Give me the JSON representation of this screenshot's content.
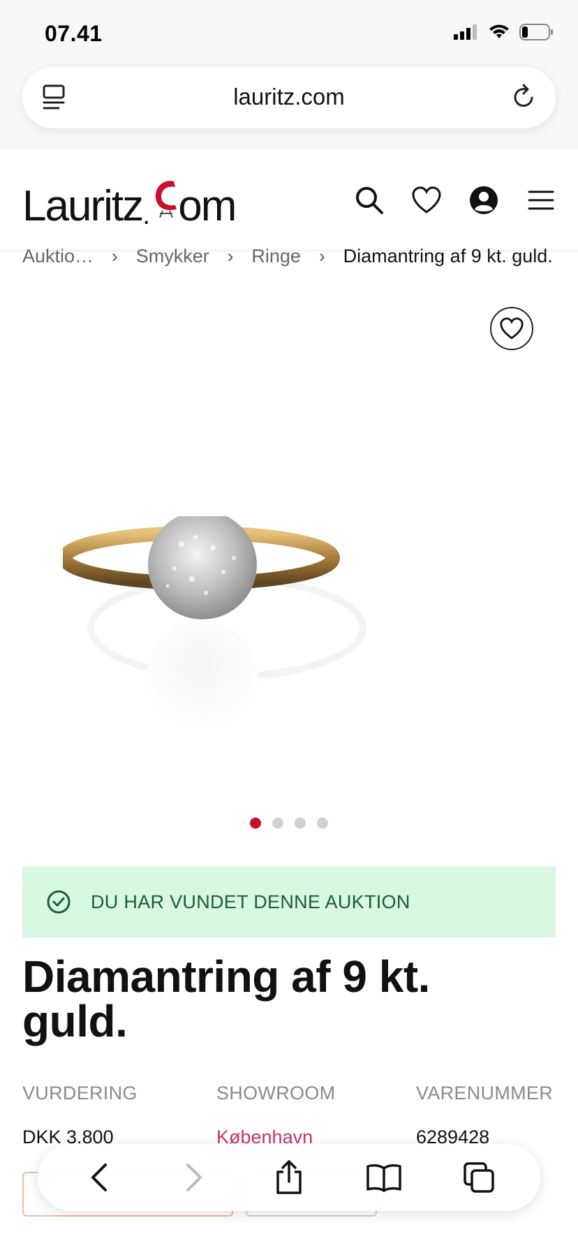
{
  "status_bar": {
    "time": "07.41"
  },
  "browser": {
    "url": "lauritz.com"
  },
  "site": {
    "logo_text_left": "Lauritz",
    "logo_text_right": "om",
    "logo_dot": ".",
    "header_icons": [
      "search-icon",
      "heart-icon",
      "user-icon",
      "menu-icon"
    ]
  },
  "breadcrumb": [
    {
      "label": "Auktio…"
    },
    {
      "label": "Smykker"
    },
    {
      "label": "Ringe"
    },
    {
      "label": "Diamantring af 9 kt. guld."
    }
  ],
  "gallery": {
    "total_images": 4,
    "active_index": 0
  },
  "won_banner": {
    "text": "DU HAR VUNDET DENNE AUKTION"
  },
  "product": {
    "title": "Diamantring af 9 kt. guld.",
    "info": [
      {
        "label": "VURDERING",
        "value": "DKK 3.800"
      },
      {
        "label": "SHOWROOM",
        "value": "København"
      },
      {
        "label": "VARENUMMER",
        "value": "6289428"
      }
    ]
  },
  "colors": {
    "accent": "#c8102e",
    "success_bg": "#d8f8e1",
    "success_text": "#1a5e32",
    "link": "#c8326a"
  }
}
